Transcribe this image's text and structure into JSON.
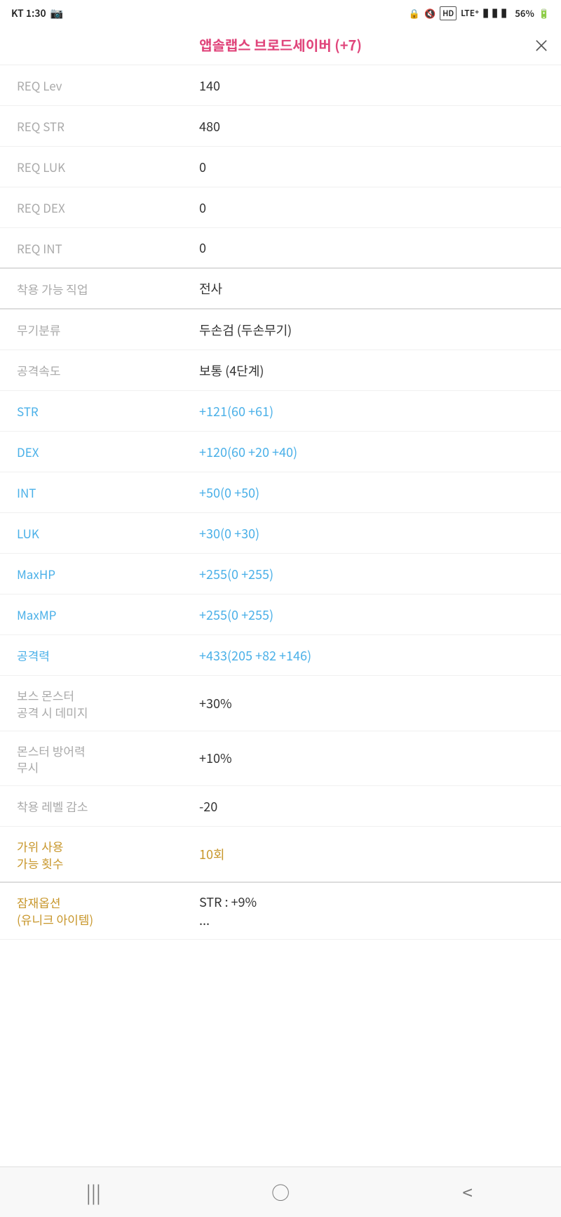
{
  "statusBar": {
    "carrier": "KT 1:30",
    "battery": "56%",
    "signal": "LTE⁺"
  },
  "titleBar": {
    "title": "앱솔랩스 브로드세이버 (+7)",
    "closeLabel": "×"
  },
  "rows": [
    {
      "label": "REQ Lev",
      "value": "140",
      "labelColor": "gray",
      "valueColor": "dark",
      "separator": false
    },
    {
      "label": "REQ STR",
      "value": "480",
      "labelColor": "gray",
      "valueColor": "dark",
      "separator": false
    },
    {
      "label": "REQ LUK",
      "value": "0",
      "labelColor": "gray",
      "valueColor": "dark",
      "separator": false
    },
    {
      "label": "REQ DEX",
      "value": "0",
      "labelColor": "gray",
      "valueColor": "dark",
      "separator": false
    },
    {
      "label": "REQ INT",
      "value": "0",
      "labelColor": "gray",
      "valueColor": "dark",
      "separator": true
    },
    {
      "label": "착용 가능 직업",
      "value": "전사",
      "labelColor": "gray",
      "valueColor": "dark",
      "separator": true
    },
    {
      "label": "무기분류",
      "value": "두손검 (두손무기)",
      "labelColor": "gray",
      "valueColor": "dark",
      "separator": false
    },
    {
      "label": "공격속도",
      "value": "보통 (4단계)",
      "labelColor": "gray",
      "valueColor": "dark",
      "separator": false
    },
    {
      "label": "STR",
      "value": "+121(60 +61)",
      "labelColor": "blue",
      "valueColor": "blue",
      "separator": false
    },
    {
      "label": "DEX",
      "value": "+120(60 +20 +40)",
      "labelColor": "blue",
      "valueColor": "blue",
      "separator": false
    },
    {
      "label": "INT",
      "value": "+50(0 +50)",
      "labelColor": "blue",
      "valueColor": "blue",
      "separator": false
    },
    {
      "label": "LUK",
      "value": "+30(0 +30)",
      "labelColor": "blue",
      "valueColor": "blue",
      "separator": false
    },
    {
      "label": "MaxHP",
      "value": "+255(0 +255)",
      "labelColor": "blue",
      "valueColor": "blue",
      "separator": false
    },
    {
      "label": "MaxMP",
      "value": "+255(0 +255)",
      "labelColor": "blue",
      "valueColor": "blue",
      "separator": false
    },
    {
      "label": "공격력",
      "value": "+433(205 +82 +146)",
      "labelColor": "blue",
      "valueColor": "blue",
      "separator": false
    },
    {
      "label": "보스 몬스터\n공격 시 데미지",
      "value": "+30%",
      "labelColor": "gray",
      "valueColor": "dark",
      "multiline": true,
      "separator": false
    },
    {
      "label": "몬스터 방어력\n무시",
      "value": "+10%",
      "labelColor": "gray",
      "valueColor": "dark",
      "multiline": true,
      "separator": false
    },
    {
      "label": "착용 레벨 감소",
      "value": "-20",
      "labelColor": "gray",
      "valueColor": "dark",
      "separator": false
    },
    {
      "label": "가위 사용\n가능 횟수",
      "value": "10회",
      "labelColor": "gold",
      "valueColor": "gold",
      "multiline": true,
      "separator": true
    },
    {
      "label": "잠재옵션\n(유니크 아이템)",
      "value": "STR : +9%\n...",
      "labelColor": "gold",
      "valueColor": "dark",
      "multiline": true,
      "separator": false
    }
  ],
  "bottomNav": {
    "backIcon": "|||",
    "homeIcon": "○",
    "prevIcon": "<"
  }
}
